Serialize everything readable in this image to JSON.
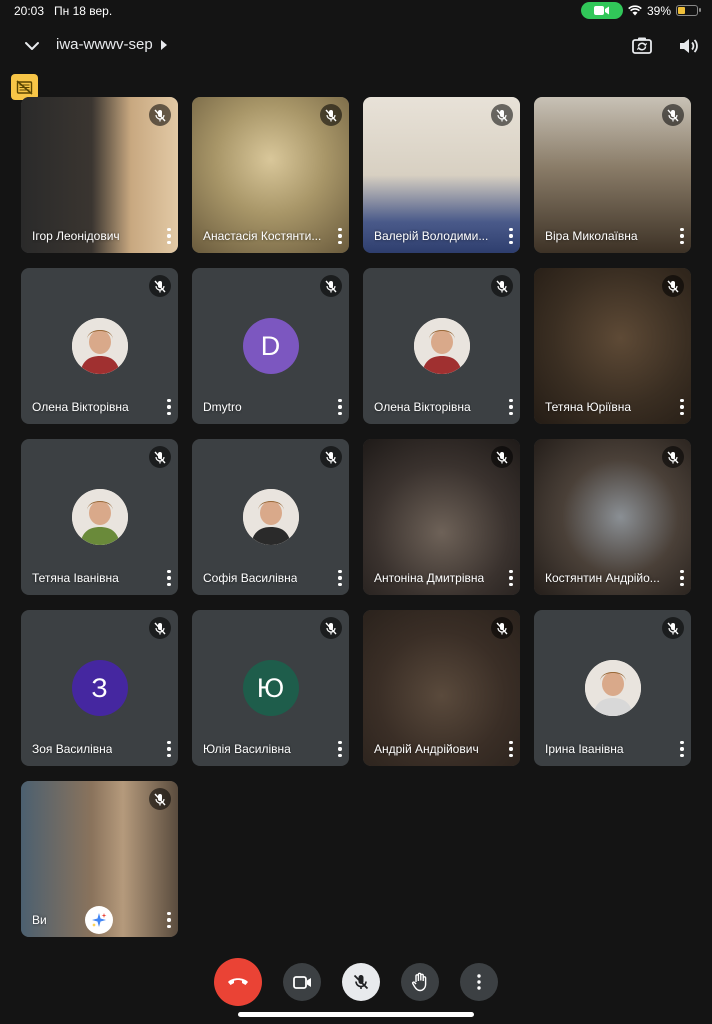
{
  "status_bar": {
    "time": "20:03",
    "date": "Пн 18 вер.",
    "battery": "39%",
    "battery_level": 0.39
  },
  "header": {
    "meeting_code": "iwa-wwwv-sep"
  },
  "participants": [
    {
      "name": "Ігор Леонідович",
      "video": true
    },
    {
      "name": "Анастасія Костянти...",
      "video": true
    },
    {
      "name": "Валерій Володими...",
      "video": true
    },
    {
      "name": "Віра Миколаївна",
      "video": true
    },
    {
      "name": "Олена Вікторівна",
      "video": false,
      "avatar": "photo"
    },
    {
      "name": "Dmytro",
      "video": false,
      "avatar": "letter",
      "letter": "D",
      "color": "#7c57c0"
    },
    {
      "name": "Олена Вікторівна",
      "video": false,
      "avatar": "photo"
    },
    {
      "name": "Тетяна Юріївна",
      "video": true
    },
    {
      "name": "Тетяна Іванівна",
      "video": false,
      "avatar": "photo"
    },
    {
      "name": "Софія Василівна",
      "video": false,
      "avatar": "photo"
    },
    {
      "name": "Антоніна Дмитрівна",
      "video": true
    },
    {
      "name": "Костянтин Андрійо...",
      "video": true
    },
    {
      "name": "Зоя Василівна",
      "video": false,
      "avatar": "letter",
      "letter": "З",
      "color": "#4527a0"
    },
    {
      "name": "Юлія Василівна",
      "video": false,
      "avatar": "letter",
      "letter": "Ю",
      "color": "#1e5d4b"
    },
    {
      "name": "Андрій Андрійович",
      "video": true
    },
    {
      "name": "Ірина Іванівна",
      "video": false,
      "avatar": "photo"
    },
    {
      "name": "Ви",
      "video": true,
      "self": true
    }
  ],
  "controls": {
    "end_call_color": "#ea4335",
    "mic_muted": true
  },
  "colors": {
    "background": "#141414",
    "tile": "#3c4043",
    "accent_yellow": "#f7c547"
  }
}
